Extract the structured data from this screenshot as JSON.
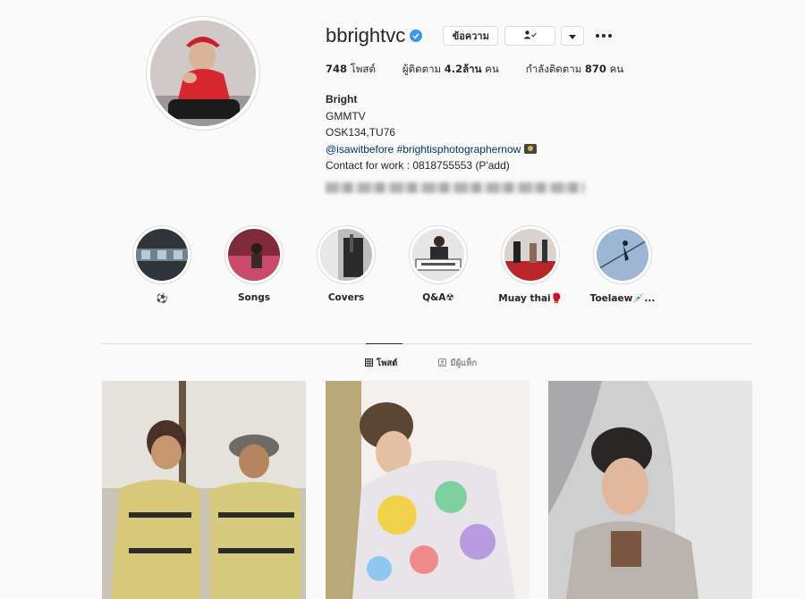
{
  "profile": {
    "username": "bbrightvc",
    "verified": true,
    "avatar_alt": "profile-avatar",
    "message_button": "ข้อความ",
    "follow_button_icon": "person-check-icon",
    "dropdown_icon": "caret-down-icon",
    "more_icon": "more-dots-icon"
  },
  "stats": {
    "posts_count": "748",
    "posts_label": "โพสต์",
    "followers_label": "ผู้ติดตาม",
    "followers_count": "4.2ล้าน",
    "followers_unit": "คน",
    "following_label": "กำลังติดตาม",
    "following_count": "870",
    "following_unit": "คน"
  },
  "bio": {
    "name": "Bright",
    "line1": "GMMTV",
    "line2": "OSK134,TU76",
    "mention": "@isawitbefore",
    "hashtag": "#brightisphotographernow",
    "contact": "Contact for work : 0818755553 (P'add)"
  },
  "highlights": [
    {
      "label": "⚽"
    },
    {
      "label": "Songs"
    },
    {
      "label": "Covers"
    },
    {
      "label": "Q&A☢"
    },
    {
      "label": "Muay thai🥊"
    },
    {
      "label": "Toelaew💉..."
    }
  ],
  "tabs": {
    "posts": "โพสต์",
    "tagged": "มีผู้แท็ก"
  },
  "colors": {
    "verified_blue": "#3897f0",
    "link_blue": "#00376b",
    "border": "#dbdbdb",
    "background": "#fafafa"
  }
}
